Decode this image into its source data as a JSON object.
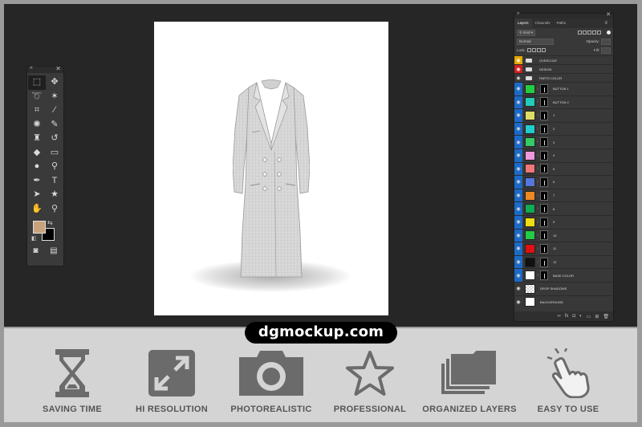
{
  "brand": {
    "text": "dgmockup.com"
  },
  "tools_panel": {
    "tools": [
      {
        "name": "marquee-tool-icon",
        "glyph": "⬚",
        "selected": true
      },
      {
        "name": "move-tool-icon",
        "glyph": "✥"
      },
      {
        "name": "lasso-tool-icon",
        "glyph": "➰"
      },
      {
        "name": "magic-wand-tool-icon",
        "glyph": "✶"
      },
      {
        "name": "crop-tool-icon",
        "glyph": "⌗"
      },
      {
        "name": "eyedropper-tool-icon",
        "glyph": "⁄"
      },
      {
        "name": "healing-brush-tool-icon",
        "glyph": "✺"
      },
      {
        "name": "brush-tool-icon",
        "glyph": "✎"
      },
      {
        "name": "clone-stamp-tool-icon",
        "glyph": "♜"
      },
      {
        "name": "history-brush-tool-icon",
        "glyph": "↺"
      },
      {
        "name": "eraser-tool-icon",
        "glyph": "◆"
      },
      {
        "name": "gradient-tool-icon",
        "glyph": "▭"
      },
      {
        "name": "blur-tool-icon",
        "glyph": "●"
      },
      {
        "name": "dodge-tool-icon",
        "glyph": "⚲"
      },
      {
        "name": "pen-tool-icon",
        "glyph": "✒"
      },
      {
        "name": "type-tool-icon",
        "glyph": "T"
      },
      {
        "name": "path-selection-tool-icon",
        "glyph": "➤"
      },
      {
        "name": "shape-tool-icon",
        "glyph": "★"
      },
      {
        "name": "hand-tool-icon",
        "glyph": "✋"
      },
      {
        "name": "zoom-tool-icon",
        "glyph": "⚲"
      }
    ],
    "foreground_color": "#c8a27a",
    "background_color": "#000000"
  },
  "layers_panel": {
    "tabs": [
      "Layers",
      "Channels",
      "Paths"
    ],
    "kind_label": "Kind",
    "blend_mode": "Normal",
    "opacity_label": "Opacity:",
    "lock_label": "Lock:",
    "fill_label": "Fill:",
    "layers": [
      {
        "name": "OVERCOAT",
        "type": "folder",
        "eye": "yellow"
      },
      {
        "name": "DESIGN",
        "type": "folder",
        "eye": "red"
      },
      {
        "name": "PARTS COLOR",
        "type": "folder",
        "eye": "none"
      },
      {
        "name": "BUTTON 1",
        "type": "color",
        "color": "#22cc44",
        "eye": "blue"
      },
      {
        "name": "BUTTON 2",
        "type": "color",
        "color": "#22ccbb",
        "eye": "blue"
      },
      {
        "name": "1",
        "type": "color",
        "color": "#dddd66",
        "eye": "blue"
      },
      {
        "name": "2",
        "type": "color",
        "color": "#22cccc",
        "eye": "blue"
      },
      {
        "name": "3",
        "type": "color",
        "color": "#33cc66",
        "eye": "blue"
      },
      {
        "name": "4",
        "type": "color",
        "color": "#ee99dd",
        "eye": "blue"
      },
      {
        "name": "5",
        "type": "color",
        "color": "#ee7777",
        "eye": "blue"
      },
      {
        "name": "6",
        "type": "color",
        "color": "#5577dd",
        "eye": "blue"
      },
      {
        "name": "7",
        "type": "color",
        "color": "#ee8822",
        "eye": "blue"
      },
      {
        "name": "8",
        "type": "color",
        "color": "#11aa55",
        "eye": "blue"
      },
      {
        "name": "9",
        "type": "color",
        "color": "#eedd11",
        "eye": "blue"
      },
      {
        "name": "10",
        "type": "color",
        "color": "#22cc44",
        "eye": "blue"
      },
      {
        "name": "11",
        "type": "color",
        "color": "#dd1111",
        "eye": "blue"
      },
      {
        "name": "12",
        "type": "color",
        "color": "#111111",
        "eye": "blue"
      },
      {
        "name": "BASE COLOR",
        "type": "white",
        "eye": "blue"
      },
      {
        "name": "DROP SHADOWS",
        "type": "checker",
        "eye": "none"
      },
      {
        "name": "BACKGROUND",
        "type": "white",
        "eye": "none"
      }
    ]
  },
  "features": [
    {
      "label": "SAVING TIME",
      "icon": "hourglass-icon"
    },
    {
      "label": "HI RESOLUTION",
      "icon": "expand-icon"
    },
    {
      "label": "PHOTOREALISTIC",
      "icon": "camera-icon"
    },
    {
      "label": "PROFESSIONAL",
      "icon": "star-icon"
    },
    {
      "label": "ORGANIZED LAYERS",
      "icon": "folders-icon"
    },
    {
      "label": "EASY TO USE",
      "icon": "hand-click-icon"
    }
  ]
}
